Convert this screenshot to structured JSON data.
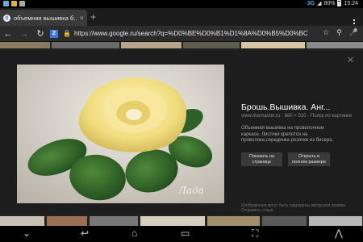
{
  "status": {
    "network": "3G",
    "battery": "80%",
    "time": "15:24"
  },
  "tab": {
    "favicon": "g",
    "title": "объемная вышивка б...",
    "close": "×",
    "new_tab": "+"
  },
  "urlbar": {
    "badge": "2",
    "url": "https://www.google.ru/search?q=%D0%BE%D0%B1%D1%8A%D0%B5%D0%BC"
  },
  "preview": {
    "image_caption": "Лада",
    "title": "Брошь.Вышивка. Анг...",
    "meta": "www.livemaster.ru · 680 × 510 · Поиск по картинке",
    "description": "Объемная вышивка на проволочном каркасе. Листики крепятся на проволоке,серединка розочки из бисера.",
    "btn_open_page": "Показать на странице",
    "btn_open_full": "Открыть в полном размере",
    "footnote": "Изображения могут быть защищены авторским правом. · Отправить отзыв"
  },
  "icons": {
    "back": "back-arrow-icon",
    "forward": "forward-arrow-icon",
    "bookmark": "bookmark-star-icon",
    "search": "search-icon",
    "mic": "microphone-icon",
    "menu": "overflow-menu-icon",
    "close": "close-icon"
  },
  "colors": {
    "accent": "#33b5e5",
    "tab_bg": "#3a3a3a",
    "panel_bg": "#1d1d1d"
  }
}
